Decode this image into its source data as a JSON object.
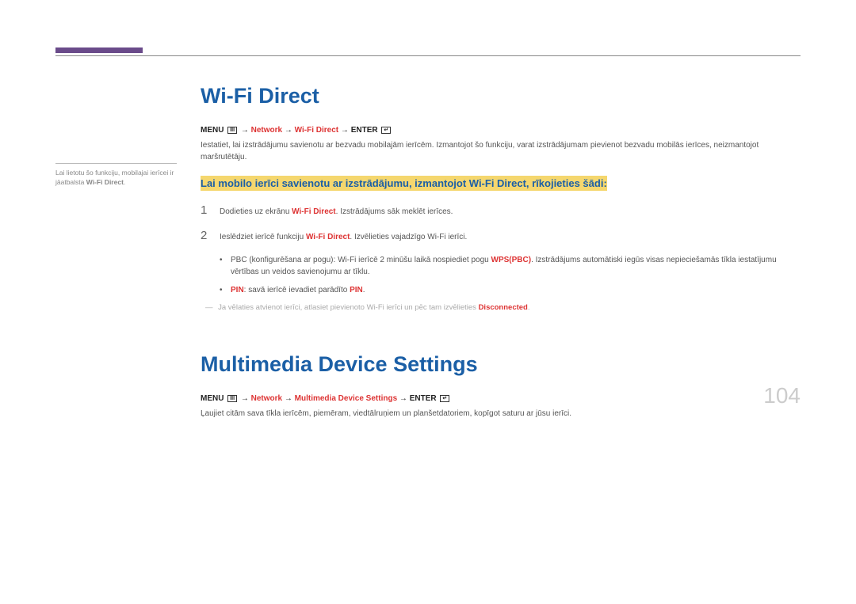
{
  "sidebar": {
    "note_prefix": "Lai lietotu šo funkciju, mobilajai ierīcei ir jāatbalsta ",
    "note_bold": "Wi-Fi Direct",
    "note_suffix": "."
  },
  "section1": {
    "title": "Wi-Fi Direct",
    "menu_prefix": "MENU ",
    "menu_arrow1": " → ",
    "menu_network": "Network",
    "menu_arrow2": " → ",
    "menu_item": "Wi-Fi Direct",
    "menu_arrow3": " → ",
    "menu_enter": "ENTER ",
    "intro": "Iestatiet, lai izstrādājumu savienotu ar bezvadu mobilajām ierīcēm. Izmantojot šo funkciju, varat izstrādājumam pievienot bezvadu mobilās ierīces, neizmantojot maršrutētāju.",
    "highlight": "Lai mobilo ierīci savienotu ar izstrādājumu, izmantojot Wi-Fi Direct, rīkojieties šādi:",
    "step1_num": "1",
    "step1_pre": "Dodieties uz ekrānu ",
    "step1_red": "Wi-Fi Direct",
    "step1_post": ". Izstrādājums sāk meklēt ierīces.",
    "step2_num": "2",
    "step2_pre": "Ieslēdziet ierīcē funkciju ",
    "step2_red": "Wi-Fi Direct",
    "step2_post": ". Izvēlieties vajadzīgo Wi-Fi ierīci.",
    "bullet1_pre": "PBC (konfigurēšana ar pogu): Wi-Fi ierīcē 2 minūšu laikā nospiediet pogu ",
    "bullet1_red": "WPS(PBC)",
    "bullet1_post": ". Izstrādājums automātiski iegūs visas nepieciešamās tīkla iestatījumu vērtības un veidos savienojumu ar tīklu.",
    "bullet2_red1": "PIN",
    "bullet2_mid": ": savā ierīcē ievadiet parādīto ",
    "bullet2_red2": "PIN",
    "bullet2_post": ".",
    "note_dash": "―",
    "note_pre": " Ja vēlaties atvienot ierīci, atlasiet pievienoto Wi-Fi ierīci un pēc tam izvēlieties ",
    "note_red": "Disconnected",
    "note_post": "."
  },
  "section2": {
    "title": "Multimedia Device Settings",
    "menu_prefix": "MENU ",
    "menu_arrow1": " → ",
    "menu_network": "Network",
    "menu_arrow2": " → ",
    "menu_item": "Multimedia Device Settings",
    "menu_arrow3": " → ",
    "menu_enter": "ENTER ",
    "intro": "Ļaujiet citām sava tīkla ierīcēm, piemēram, viedtālruņiem un planšetdatoriem, kopīgot saturu ar jūsu ierīci."
  },
  "icons": {
    "menu_glyph": "III",
    "enter_glyph": "↵"
  },
  "page_number": "104"
}
